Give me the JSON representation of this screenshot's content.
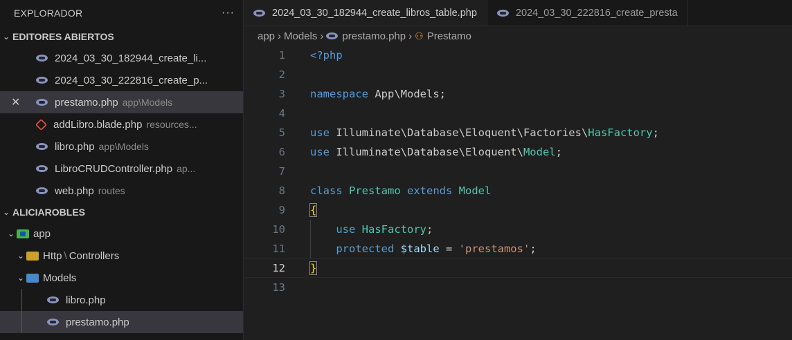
{
  "sidebar": {
    "title": "EXPLORADOR",
    "more": "···",
    "open_editors_title": "EDITORES ABIERTOS",
    "open_editors": [
      {
        "name": "2024_03_30_182944_create_li...",
        "desc": "",
        "icon": "php-icon"
      },
      {
        "name": "2024_03_30_222816_create_p...",
        "desc": "",
        "icon": "php-icon"
      },
      {
        "name": "prestamo.php",
        "desc": "app\\Models",
        "icon": "php-icon",
        "active": true
      },
      {
        "name": "addLibro.blade.php",
        "desc": "resources...",
        "icon": "laravel-icon"
      },
      {
        "name": "libro.php",
        "desc": "app\\Models",
        "icon": "php-icon"
      },
      {
        "name": "LibroCRUDController.php",
        "desc": "ap...",
        "icon": "php-icon"
      },
      {
        "name": "web.php",
        "desc": "routes",
        "icon": "php-icon"
      }
    ],
    "close_glyph": "✕",
    "project_title": "ALICIAROBLES",
    "tree": {
      "app": "app",
      "http": "Http",
      "http_sep": "\\",
      "controllers": "Controllers",
      "models": "Models",
      "files": [
        "libro.php",
        "prestamo.php"
      ]
    }
  },
  "tabs": [
    {
      "label": "2024_03_30_182944_create_libros_table.php"
    },
    {
      "label": "2024_03_30_222816_create_presta"
    }
  ],
  "breadcrumb": {
    "root": "app",
    "folder": "Models",
    "file": "prestamo.php",
    "symbol": "Prestamo"
  },
  "editor": {
    "current_line": 12,
    "lines": [
      {
        "n": "1"
      },
      {
        "n": "2"
      },
      {
        "n": "3"
      },
      {
        "n": "4"
      },
      {
        "n": "5"
      },
      {
        "n": "6"
      },
      {
        "n": "7"
      },
      {
        "n": "8"
      },
      {
        "n": "9"
      },
      {
        "n": "10"
      },
      {
        "n": "11"
      },
      {
        "n": "12"
      },
      {
        "n": "13"
      }
    ],
    "code": {
      "l1": "<?php",
      "l3_kw": "namespace",
      "l3_rest": " App\\Models;",
      "l5_kw": "use",
      "l5_rest": " Illuminate\\Database\\Eloquent\\Factories\\",
      "l5_ty": "HasFactory",
      "l5_end": ";",
      "l6_kw": "use",
      "l6_rest": " Illuminate\\Database\\Eloquent\\",
      "l6_ty": "Model",
      "l6_end": ";",
      "l8_kw": "class",
      "l8_ty": " Prestamo",
      "l8_kw2": " extends",
      "l8_ty2": " Model",
      "l9": "{",
      "l10_kw": "use",
      "l10_ty": " HasFactory",
      "l10_end": ";",
      "l11_kw": "protected",
      "l11_var": " $table",
      "l11_op": " = ",
      "l11_str": "'prestamos'",
      "l11_end": ";",
      "l12": "}"
    }
  },
  "colors": {
    "keyword": "#569cd6",
    "type": "#4ec9b0",
    "string": "#ce9178",
    "variable": "#9cdcfe",
    "active_row": "#37373d"
  }
}
